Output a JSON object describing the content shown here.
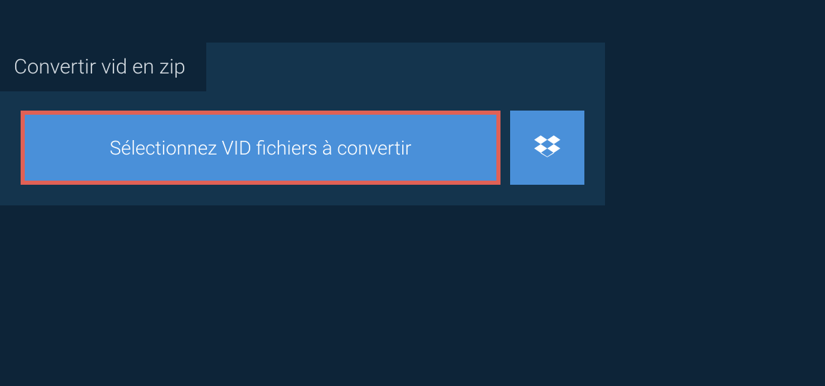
{
  "tab": {
    "title": "Convertir vid en zip"
  },
  "buttons": {
    "select_label": "Sélectionnez VID fichiers à convertir"
  }
}
